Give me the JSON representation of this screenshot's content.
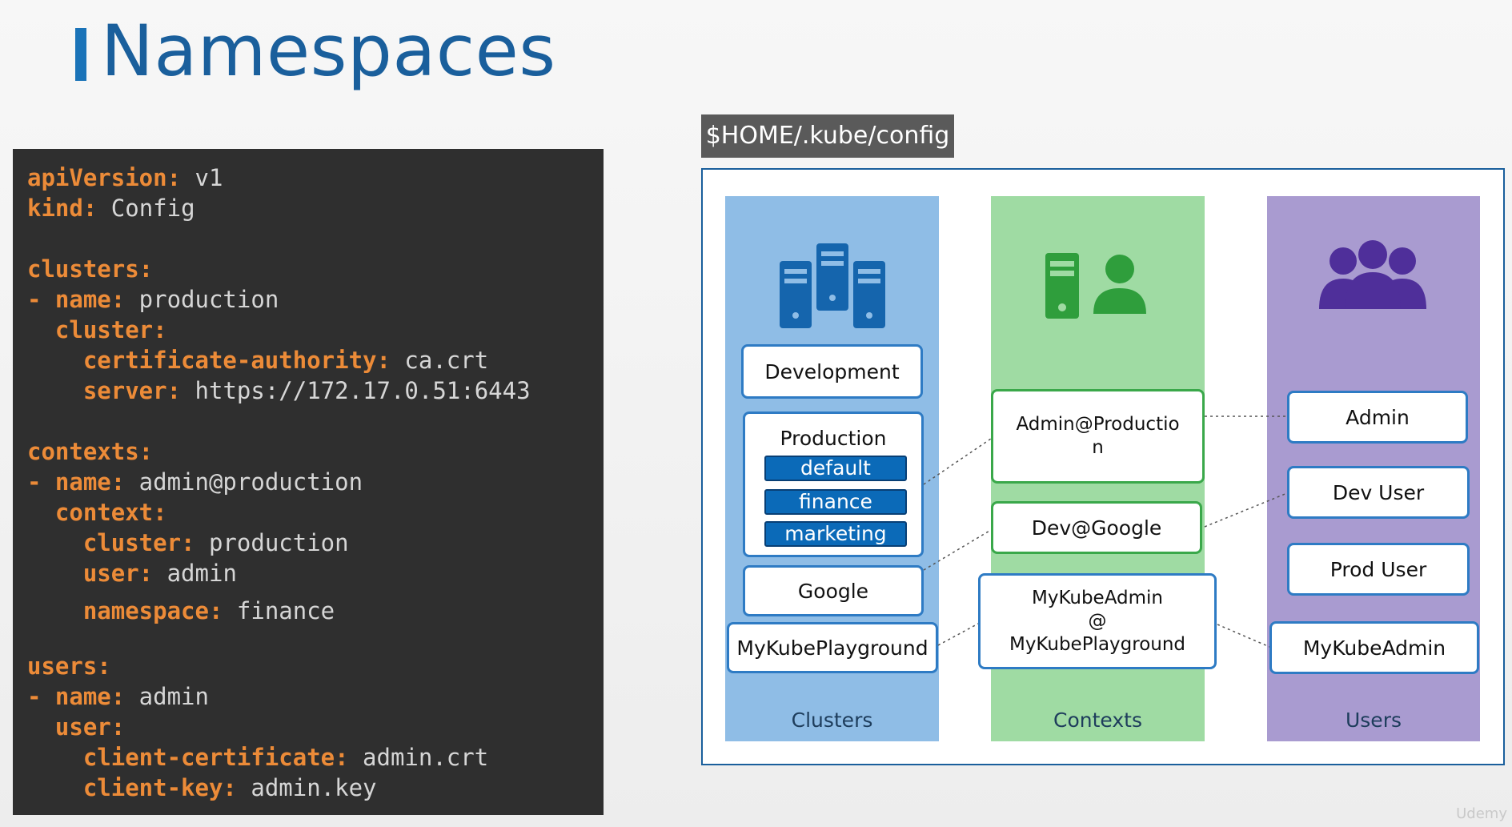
{
  "page": {
    "title": "Namespaces",
    "watermark": "Udemy"
  },
  "code": {
    "lines": [
      {
        "key": "apiVersion:",
        "value": " v1"
      },
      {
        "key": "kind:",
        "value": " Config"
      },
      {
        "key": "clusters:",
        "value": ""
      },
      {
        "key": "- name:",
        "value": " production"
      },
      {
        "key": "  cluster:",
        "value": ""
      },
      {
        "key": "    certificate-authority:",
        "value": " ca.crt"
      },
      {
        "key": "    server:",
        "value": " https://172.17.0.51:6443"
      },
      {
        "key": "contexts:",
        "value": ""
      },
      {
        "key": "- name:",
        "value": " admin@production"
      },
      {
        "key": "  context:",
        "value": ""
      },
      {
        "key": "    cluster:",
        "value": " production"
      },
      {
        "key": "    user:",
        "value": " admin"
      },
      {
        "key": "    namespace:",
        "value": " finance"
      },
      {
        "key": "users:",
        "value": ""
      },
      {
        "key": "- name:",
        "value": " admin"
      },
      {
        "key": "  user:",
        "value": ""
      },
      {
        "key": "    client-certificate:",
        "value": " admin.crt"
      },
      {
        "key": "    client-key:",
        "value": " admin.key"
      }
    ]
  },
  "diagram": {
    "file_label": "$HOME/.kube/config",
    "clusters": {
      "label": "Clusters",
      "items": [
        "Development",
        "Production",
        "Google",
        "MyKubePlayground"
      ],
      "namespaces": [
        "default",
        "finance",
        "marketing"
      ]
    },
    "contexts": {
      "label": "Contexts",
      "items": [
        "Admin@Productio\nn",
        "Dev@Google",
        "MyKubeAdmin\n@\nMyKubePlayground"
      ]
    },
    "users": {
      "label": "Users",
      "items": [
        "Admin",
        "Dev User",
        "Prod User",
        "MyKubeAdmin"
      ]
    },
    "colors": {
      "clusters": "#8fbde6",
      "contexts": "#9fdba3",
      "users": "#a99bd0",
      "frame": "#1a5f9c",
      "namespace": "#0b6ab8",
      "code_key": "#ec8b38"
    },
    "icons": [
      "servers-icon",
      "server-user-icon",
      "users-group-icon"
    ]
  }
}
